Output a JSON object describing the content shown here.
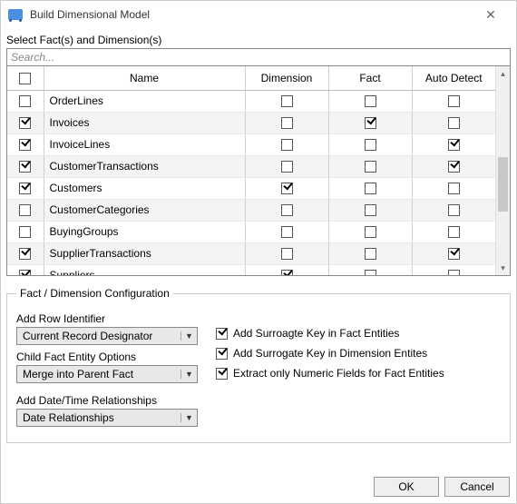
{
  "window": {
    "title": "Build Dimensional Model"
  },
  "section_label": "Select Fact(s) and Dimension(s)",
  "search": {
    "placeholder": "Search..."
  },
  "columns": {
    "name": "Name",
    "dimension": "Dimension",
    "fact": "Fact",
    "auto": "Auto Detect"
  },
  "header_checked": false,
  "rows": [
    {
      "sel": false,
      "name": "OrderLines",
      "dim": false,
      "fact": false,
      "auto": false
    },
    {
      "sel": true,
      "name": "Invoices",
      "dim": false,
      "fact": true,
      "auto": false
    },
    {
      "sel": true,
      "name": "InvoiceLines",
      "dim": false,
      "fact": false,
      "auto": true
    },
    {
      "sel": true,
      "name": "CustomerTransactions",
      "dim": false,
      "fact": false,
      "auto": true
    },
    {
      "sel": true,
      "name": "Customers",
      "dim": true,
      "fact": false,
      "auto": false
    },
    {
      "sel": false,
      "name": "CustomerCategories",
      "dim": false,
      "fact": false,
      "auto": false
    },
    {
      "sel": false,
      "name": "BuyingGroups",
      "dim": false,
      "fact": false,
      "auto": false
    },
    {
      "sel": true,
      "name": "SupplierTransactions",
      "dim": false,
      "fact": false,
      "auto": true
    },
    {
      "sel": true,
      "name": "Suppliers",
      "dim": true,
      "fact": false,
      "auto": false
    }
  ],
  "config": {
    "legend": "Fact / Dimension Configuration",
    "row_id_label": "Add Row Identifier",
    "row_id_value": "Current Record Designator",
    "child_label": "Child Fact Entity Options",
    "child_value": "Merge into Parent Fact",
    "date_label": "Add Date/Time Relationships",
    "date_value": "Date Relationships",
    "opt1": {
      "checked": true,
      "label": "Add Surroagte Key in Fact Entities"
    },
    "opt2": {
      "checked": true,
      "label": "Add Surrogate Key in Dimension Entites"
    },
    "opt3": {
      "checked": true,
      "label": "Extract only Numeric Fields for Fact Entities"
    }
  },
  "buttons": {
    "ok": "OK",
    "cancel": "Cancel"
  }
}
